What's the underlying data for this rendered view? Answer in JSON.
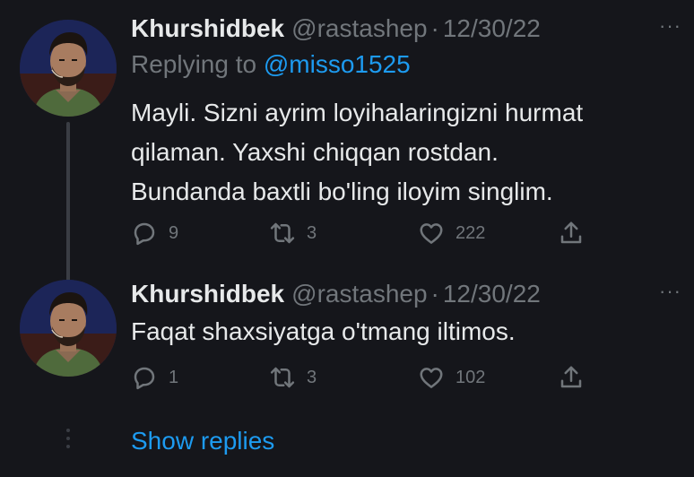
{
  "tweets": [
    {
      "name": "Khurshidbek",
      "handle": "@rastashep",
      "separator": "·",
      "date": "12/30/22",
      "more_label": "···",
      "replying_prefix": "Replying to",
      "replying_to": "@misso1525",
      "text_lines": [
        "Mayli. Sizni ayrim loyihalaringizni hurmat",
        "qilaman. Yaxshi chiqqan rostdan.",
        "Bundanda baxtli bo'ling iloyim singlim."
      ],
      "replies": "9",
      "retweets": "3",
      "likes": "222"
    },
    {
      "name": "Khurshidbek",
      "handle": "@rastashep",
      "separator": "·",
      "date": "12/30/22",
      "more_label": "···",
      "text_lines": [
        "Faqat shaxsiyatga o'tmang iltimos."
      ],
      "replies": "1",
      "retweets": "3",
      "likes": "102"
    }
  ],
  "show_replies_label": "Show replies",
  "icons": {
    "reply": "speech-bubble-icon",
    "retweet": "retweet-arrows-icon",
    "like": "heart-icon",
    "share": "share-upload-icon",
    "more": "more-dots-icon"
  },
  "colors": {
    "background": "#15161b",
    "text": "#e7e9ea",
    "muted": "#71767b",
    "accent": "#1d9bf0",
    "thread_line": "#3a3d44"
  }
}
